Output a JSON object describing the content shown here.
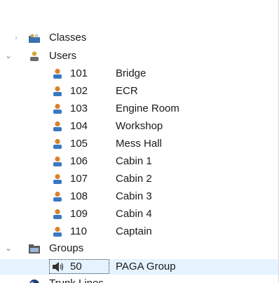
{
  "tree": {
    "classes": {
      "label": "Classes",
      "icon": "classes-folder-icon"
    },
    "users": {
      "label": "Users",
      "icon": "users-group-icon",
      "items": [
        {
          "number": "101",
          "name": "Bridge"
        },
        {
          "number": "102",
          "name": "ECR"
        },
        {
          "number": "103",
          "name": "Engine Room"
        },
        {
          "number": "104",
          "name": "Workshop"
        },
        {
          "number": "105",
          "name": "Mess Hall"
        },
        {
          "number": "106",
          "name": "Cabin 1"
        },
        {
          "number": "107",
          "name": "Cabin 2"
        },
        {
          "number": "108",
          "name": "Cabin 3"
        },
        {
          "number": "109",
          "name": "Cabin 4"
        },
        {
          "number": "110",
          "name": "Captain"
        }
      ]
    },
    "groups": {
      "label": "Groups",
      "icon": "groups-folder-icon",
      "items": [
        {
          "number": "50",
          "name": "PAGA Group",
          "icon": "speaker-icon"
        }
      ]
    },
    "trunk_lines": {
      "label": "Trunk Lines",
      "icon": "trunk-lines-icon"
    }
  },
  "colors": {
    "selection": "#e5f3ff",
    "user_head": "#d9822b",
    "user_body": "#3a78c2"
  }
}
